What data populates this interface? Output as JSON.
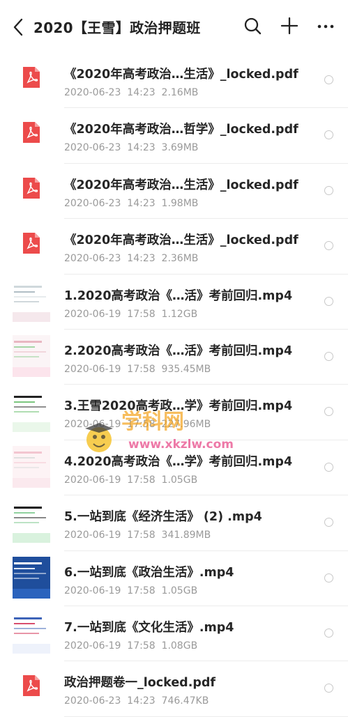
{
  "header": {
    "title": "2020【王雪】政治押题班",
    "back_icon": "chevron-left-icon",
    "search_icon": "search-icon",
    "add_icon": "plus-icon",
    "more_icon": "more-horizontal-icon"
  },
  "files": [
    {
      "name": "《2020年高考政治…生活》_locked.pdf",
      "date": "2020-06-23",
      "time": "14:23",
      "size": "2.16MB",
      "type": "pdf"
    },
    {
      "name": "《2020年高考政治…哲学》_locked.pdf",
      "date": "2020-06-23",
      "time": "14:23",
      "size": "3.69MB",
      "type": "pdf"
    },
    {
      "name": "《2020年高考政治…生活》_locked.pdf",
      "date": "2020-06-23",
      "time": "14:23",
      "size": "1.98MB",
      "type": "pdf"
    },
    {
      "name": "《2020年高考政治…生活》_locked.pdf",
      "date": "2020-06-23",
      "time": "14:23",
      "size": "2.36MB",
      "type": "pdf"
    },
    {
      "name": "1.2020高考政治《…活》考前回归.mp4",
      "date": "2020-06-19",
      "time": "17:58",
      "size": "1.12GB",
      "type": "video"
    },
    {
      "name": "2.2020高考政治《…活》考前回归.mp4",
      "date": "2020-06-19",
      "time": "17:58",
      "size": "935.45MB",
      "type": "video"
    },
    {
      "name": "3.王雪2020高考政…学》考前回归.mp4",
      "date": "2020-06-19",
      "time": "17:58",
      "size": "227.96MB",
      "type": "video"
    },
    {
      "name": "4.2020高考政治《…学》考前回归.mp4",
      "date": "2020-06-19",
      "time": "17:58",
      "size": "1.05GB",
      "type": "video"
    },
    {
      "name": "5.一站到底《经济生活》 (2) .mp4",
      "date": "2020-06-19",
      "time": "17:58",
      "size": "341.89MB",
      "type": "video"
    },
    {
      "name": "6.一站到底《政治生活》.mp4",
      "date": "2020-06-19",
      "time": "17:58",
      "size": "1.05GB",
      "type": "video"
    },
    {
      "name": "7.一站到底《文化生活》.mp4",
      "date": "2020-06-19",
      "time": "17:58",
      "size": "1.08GB",
      "type": "video"
    },
    {
      "name": "政治押题卷一_locked.pdf",
      "date": "2020-06-23",
      "time": "14:23",
      "size": "746.47KB",
      "type": "pdf"
    }
  ],
  "watermark": {
    "text_cn": "学科网",
    "text_url": "www.xkzlw.com"
  },
  "colors": {
    "pdf_red": "#ec4b4b",
    "accent_orange": "#f4a21a",
    "accent_pink": "#e84d8a"
  }
}
